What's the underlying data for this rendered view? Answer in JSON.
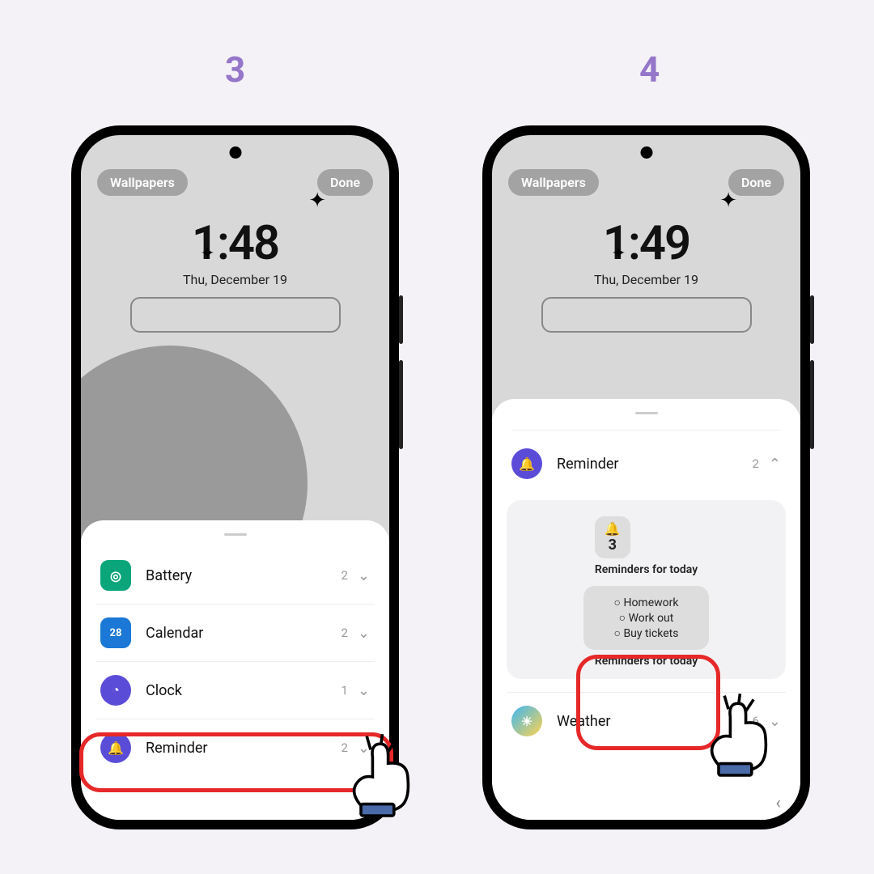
{
  "steps": {
    "left": "3",
    "right": "4"
  },
  "phone3": {
    "wallpapers": "Wallpapers",
    "done": "Done",
    "time": "1:48",
    "date": "Thu, December 19",
    "widgets": [
      {
        "label": "Battery",
        "count": "2",
        "iconBg": "#0aa57a",
        "iconChar": "◎"
      },
      {
        "label": "Calendar",
        "count": "2",
        "iconBg": "#1b78d6",
        "iconChar": "28"
      },
      {
        "label": "Clock",
        "count": "1",
        "iconBg": "#5b4cd8",
        "iconChar": "◔"
      },
      {
        "label": "Reminder",
        "count": "2",
        "iconBg": "#5b4cd8",
        "iconChar": "🔔"
      }
    ]
  },
  "phone4": {
    "wallpapers": "Wallpapers",
    "done": "Done",
    "time": "1:49",
    "date": "Thu, December 19",
    "reminder": {
      "label": "Reminder",
      "count": "2",
      "badgeNum": "3",
      "cardTitle": "Reminders for today",
      "items": [
        "Homework",
        "Work out",
        "Buy tickets"
      ],
      "listTitle": "Reminders for today"
    },
    "weather": {
      "label": "Weather",
      "count": "6"
    }
  }
}
